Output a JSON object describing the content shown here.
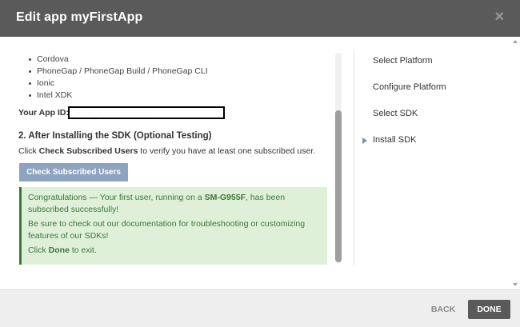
{
  "header": {
    "title": "Edit app myFirstApp",
    "close_glyph": "×"
  },
  "platforms": [
    "Cordova",
    "PhoneGap / PhoneGap Build / PhoneGap CLI",
    "Ionic",
    "Intel XDK"
  ],
  "app_id": {
    "label": "Your App ID:",
    "value": "··· ···· ·· ···· ····  ··· ··· ·"
  },
  "section": {
    "title": "2. After Installing the SDK (Optional Testing)",
    "instruction_pre": "Click ",
    "instruction_bold": "Check Subscribed Users",
    "instruction_post": " to verify you have at least one subscribed user.",
    "check_button": "Check Subscribed Users"
  },
  "alert": {
    "line1_pre": "Congratulations — Your first user, running on a ",
    "device": "SM-G955F",
    "line1_post": ", has been subscribed successfully!",
    "line2": "Be sure to check out our documentation for troubleshooting or customizing features of our SDKs!",
    "line3_pre": "Click ",
    "line3_bold": "Done",
    "line3_post": " to exit."
  },
  "steps": [
    {
      "label": "Select Platform",
      "active": false
    },
    {
      "label": "Configure Platform",
      "active": false
    },
    {
      "label": "Select SDK",
      "active": false
    },
    {
      "label": "Install SDK",
      "active": true
    }
  ],
  "footer": {
    "back_label": "BACK",
    "done_label": "DONE"
  },
  "colors": {
    "header_bg": "#5a5a5a",
    "alert_bg": "#dff0d8",
    "alert_text": "#3c763d",
    "button_blue": "#8ea3bf"
  }
}
